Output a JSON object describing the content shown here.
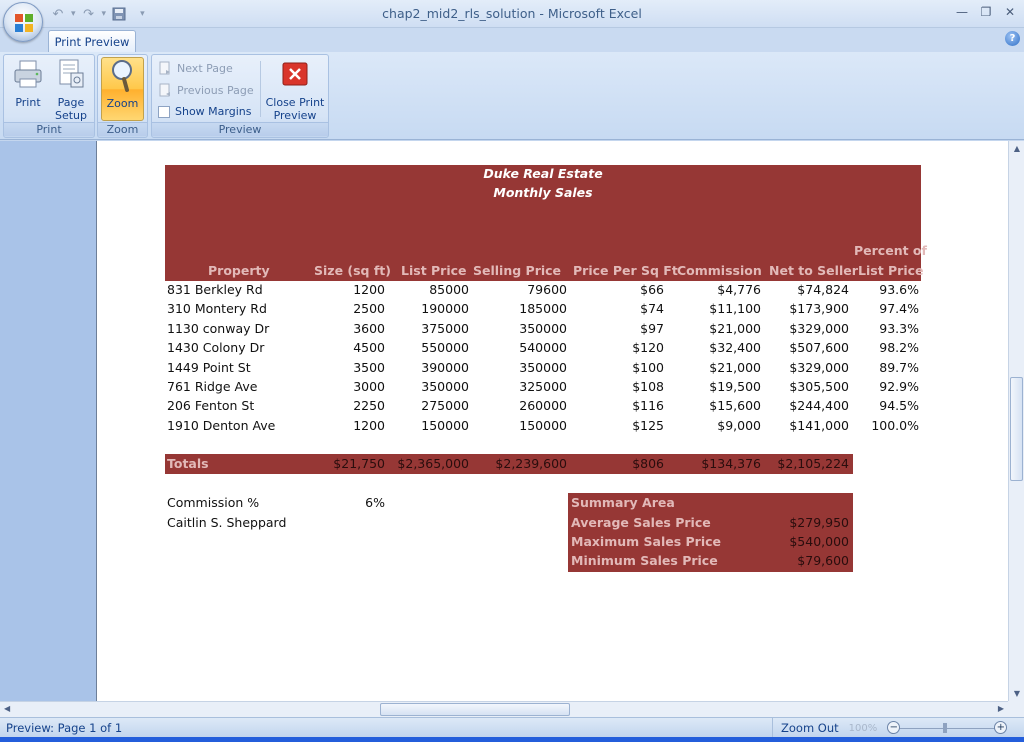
{
  "window": {
    "title": "chap2_mid2_rls_solution - Microsoft Excel"
  },
  "ribbon": {
    "active_tab": "Print Preview",
    "groups": {
      "print": {
        "label": "Print",
        "print_label": "Print",
        "page_setup_line1": "Page",
        "page_setup_line2": "Setup"
      },
      "zoom": {
        "label": "Zoom",
        "zoom_label": "Zoom"
      },
      "preview": {
        "label": "Preview",
        "next_page": "Next Page",
        "previous_page": "Previous Page",
        "show_margins": "Show Margins",
        "close_line1": "Close Print",
        "close_line2": "Preview"
      }
    }
  },
  "sheet": {
    "title1": "Duke Real Estate",
    "title2": "Monthly Sales",
    "headers": {
      "property": "Property",
      "size": "Size (sq ft)",
      "list_price": "List Price",
      "selling_price": "Selling Price",
      "price_per_sqft": "Price Per Sq Ft",
      "commission": "Commission",
      "net_to_seller": "Net to Seller",
      "percent_line1": "Percent of",
      "percent_line2": "List Price"
    },
    "rows": [
      {
        "property": "831 Berkley Rd",
        "size": "1200",
        "list": "85000",
        "sell": "79600",
        "ppsf": "$66",
        "comm": "$4,776",
        "net": "$74,824",
        "pct": "93.6%"
      },
      {
        "property": "310 Montery Rd",
        "size": "2500",
        "list": "190000",
        "sell": "185000",
        "ppsf": "$74",
        "comm": "$11,100",
        "net": "$173,900",
        "pct": "97.4%"
      },
      {
        "property": "1130 conway Dr",
        "size": "3600",
        "list": "375000",
        "sell": "350000",
        "ppsf": "$97",
        "comm": "$21,000",
        "net": "$329,000",
        "pct": "93.3%"
      },
      {
        "property": "1430 Colony Dr",
        "size": "4500",
        "list": "550000",
        "sell": "540000",
        "ppsf": "$120",
        "comm": "$32,400",
        "net": "$507,600",
        "pct": "98.2%"
      },
      {
        "property": "1449 Point St",
        "size": "3500",
        "list": "390000",
        "sell": "350000",
        "ppsf": "$100",
        "comm": "$21,000",
        "net": "$329,000",
        "pct": "89.7%"
      },
      {
        "property": "761 Ridge Ave",
        "size": "3000",
        "list": "350000",
        "sell": "325000",
        "ppsf": "$108",
        "comm": "$19,500",
        "net": "$305,500",
        "pct": "92.9%"
      },
      {
        "property": "206 Fenton St",
        "size": "2250",
        "list": "275000",
        "sell": "260000",
        "ppsf": "$116",
        "comm": "$15,600",
        "net": "$244,400",
        "pct": "94.5%"
      },
      {
        "property": "1910 Denton Ave",
        "size": "1200",
        "list": "150000",
        "sell": "150000",
        "ppsf": "$125",
        "comm": "$9,000",
        "net": "$141,000",
        "pct": "100.0%"
      }
    ],
    "totals": {
      "label": "Totals",
      "size": "$21,750",
      "list": "$2,365,000",
      "sell": "$2,239,600",
      "ppsf": "$806",
      "comm": "$134,376",
      "net": "$2,105,224"
    },
    "commission_label": "Commission %",
    "commission_value": "6%",
    "author": "Caitlin S. Sheppard",
    "summary": {
      "title": "Summary Area",
      "avg_label": "Average Sales Price",
      "avg_value": "$279,950",
      "max_label": "Maximum Sales Price",
      "max_value": "$540,000",
      "min_label": "Minimum Sales Price",
      "min_value": "$79,600"
    }
  },
  "status": {
    "page_info": "Preview: Page 1 of 1",
    "zoom_out": "Zoom Out",
    "zoom_pct": "100%"
  },
  "colors": {
    "header_fill": "#963735",
    "header_text": "#e2b9b8"
  }
}
